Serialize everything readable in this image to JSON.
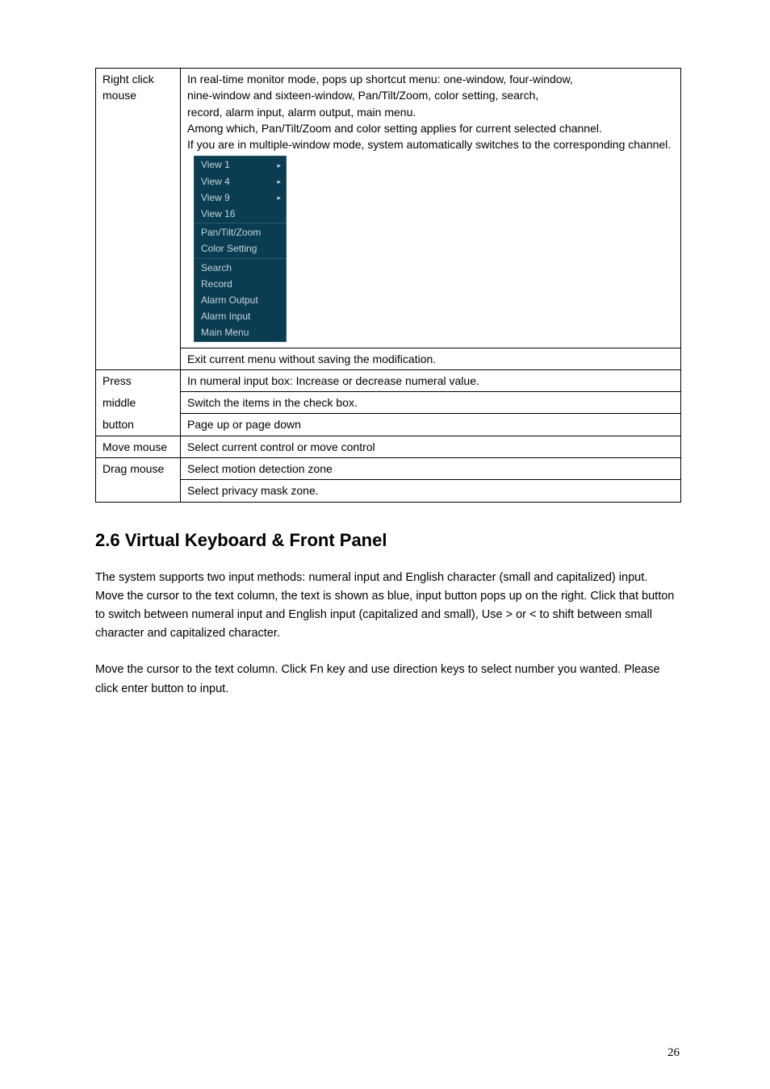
{
  "table": {
    "rows": [
      {
        "left": "Right click mouse",
        "type": "rightclick",
        "desc_lines": [
          "In real-time monitor mode, pops up shortcut menu: one-window, four-window,",
          "nine-window and sixteen-window, Pan/Tilt/Zoom, color setting, search,",
          "record, alarm input, alarm output, main menu.",
          "Among which, Pan/Tilt/Zoom and color setting applies for current selected channel.",
          "If you are in multiple-window mode, system automatically switches to the corresponding channel."
        ],
        "menu": {
          "group1": [
            {
              "label": "View 1",
              "arrow": true
            },
            {
              "label": "View 4",
              "arrow": true
            },
            {
              "label": "View 9",
              "arrow": true
            },
            {
              "label": "View 16",
              "arrow": false
            }
          ],
          "group2": [
            {
              "label": "Pan/Tilt/Zoom",
              "arrow": false
            },
            {
              "label": "Color Setting",
              "arrow": false
            }
          ],
          "group3": [
            {
              "label": "Search",
              "arrow": false
            },
            {
              "label": "Record",
              "arrow": false
            },
            {
              "label": "Alarm Output",
              "arrow": false
            },
            {
              "label": "Alarm Input",
              "arrow": false
            },
            {
              "label": "Main Menu",
              "arrow": false
            }
          ]
        },
        "exit_line": "Exit current menu without saving the modification."
      },
      {
        "left": "Press",
        "right": "In numeral input box:  Increase or decrease numeral value."
      },
      {
        "left": "middle",
        "right": "Switch the items in the check box."
      },
      {
        "left": "button",
        "right": "Page up or page down"
      },
      {
        "left": "Move mouse",
        "right": "Select current control or move control"
      },
      {
        "left": "Drag mouse",
        "right1": "Select motion detection zone",
        "right2": "Select privacy mask zone."
      }
    ]
  },
  "section": {
    "heading": "2.6  Virtual Keyboard & Front Panel",
    "para1": "The system supports two input methods: numeral input and English character (small and capitalized) input.",
    "para1b": "Move the cursor to the text column, the text is shown as blue, input button pops up on the right. Click that button to switch between numeral input and English input (capitalized and small), Use > or < to shift between small character and capitalized character.",
    "para2": "Move the cursor to the text column. Click Fn key and use direction keys to select number you wanted.  Please click enter button to input."
  },
  "page_number": "26",
  "arrow_glyph": "▸"
}
